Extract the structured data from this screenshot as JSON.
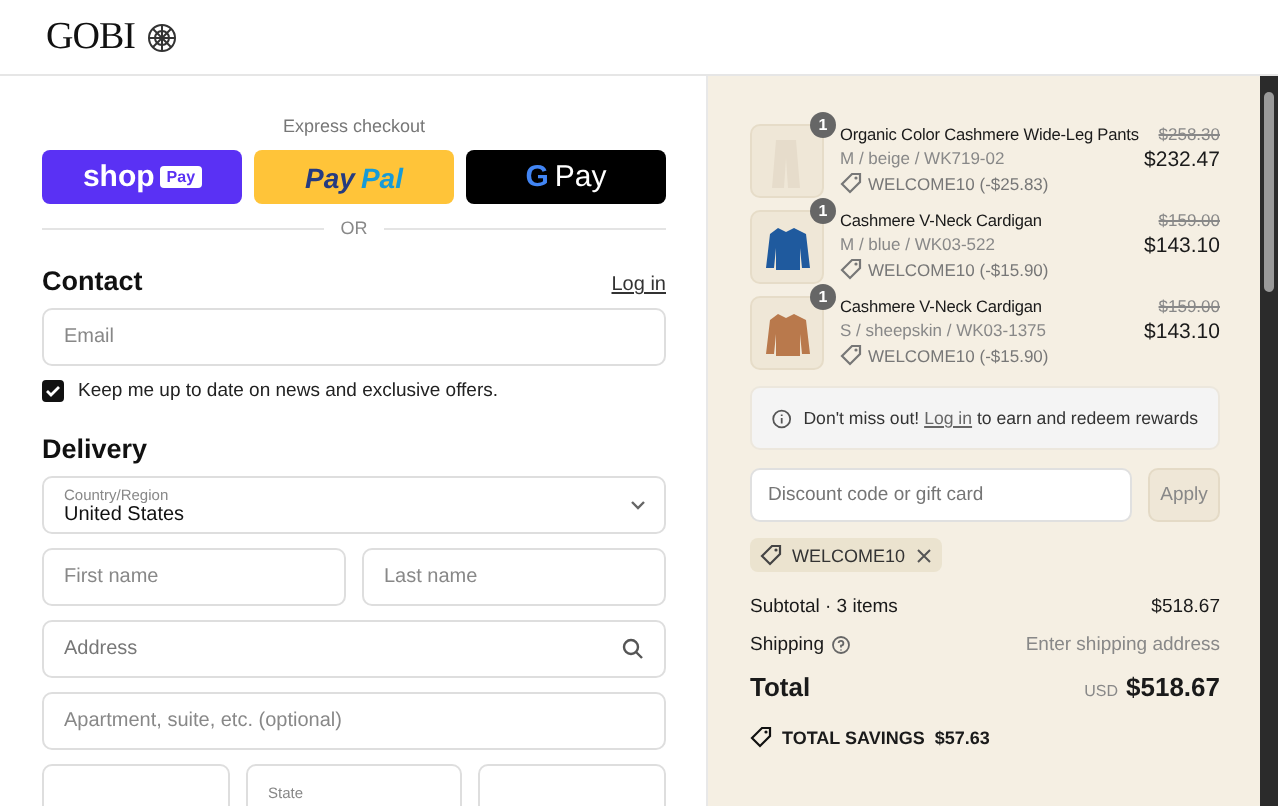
{
  "header": {
    "logo": "GOBI"
  },
  "express_checkout": {
    "title": "Express checkout",
    "buttons": [
      {
        "kind": "shoppay",
        "parts": [
          "shop",
          "Pay"
        ]
      },
      {
        "kind": "paypal",
        "parts": [
          "Pay",
          "Pal"
        ]
      },
      {
        "kind": "gpay",
        "parts": [
          "G",
          "Pay"
        ]
      }
    ],
    "divider": "OR"
  },
  "contact": {
    "heading": "Contact",
    "login_link": "Log in",
    "email": {
      "placeholder": "Email"
    },
    "newsletter": {
      "label": "Keep me up to date on news and exclusive offers.",
      "checked": true
    }
  },
  "delivery": {
    "heading": "Delivery",
    "rows": [
      [
        {
          "kind": "select",
          "label": "Country/Region",
          "value": "United States"
        }
      ],
      [
        {
          "kind": "text",
          "placeholder": "First name"
        },
        {
          "kind": "text",
          "placeholder": "Last name"
        }
      ],
      [
        {
          "kind": "search",
          "placeholder": "Address"
        }
      ],
      [
        {
          "kind": "text",
          "placeholder": "Apartment, suite, etc. (optional)"
        }
      ],
      [
        {
          "kind": "text"
        },
        {
          "kind": "select",
          "label": "State"
        },
        {
          "kind": "text"
        }
      ]
    ]
  },
  "summary": {
    "items": [
      {
        "kind": "pants",
        "color": "#e6dccb",
        "quantity": "1",
        "name": "Organic Color Cashmere Wide-Leg Pants",
        "variant": "M / beige / WK719-02",
        "discount": "WELCOME10 (-$25.83)",
        "original_price": "$258.30",
        "price": "$232.47"
      },
      {
        "kind": "sweater",
        "color": "#1f5a9e",
        "quantity": "1",
        "name": "Cashmere V-Neck Cardigan",
        "variant": "M / blue / WK03-522",
        "discount": "WELCOME10 (-$15.90)",
        "original_price": "$159.00",
        "price": "$143.10"
      },
      {
        "kind": "sweater",
        "color": "#b9794c",
        "quantity": "1",
        "name": "Cashmere V-Neck Cardigan",
        "variant": "S / sheepskin / WK03-1375",
        "discount": "WELCOME10 (-$15.90)",
        "original_price": "$159.00",
        "price": "$143.10"
      }
    ],
    "rewards_notice": {
      "before": "Don't miss out!",
      "link": "Log in",
      "after": "to earn and redeem rewards"
    },
    "discount": {
      "placeholder": "Discount code or gift card",
      "button": "Apply",
      "applied_codes": [
        "WELCOME10"
      ]
    },
    "subtotal": {
      "label": "Subtotal · 3 items",
      "value": "$518.67"
    },
    "shipping": {
      "label": "Shipping",
      "value": "Enter shipping address"
    },
    "total": {
      "label": "Total",
      "currency": "USD",
      "value": "$518.67"
    },
    "savings": {
      "label": "TOTAL SAVINGS",
      "value": "$57.63"
    }
  }
}
